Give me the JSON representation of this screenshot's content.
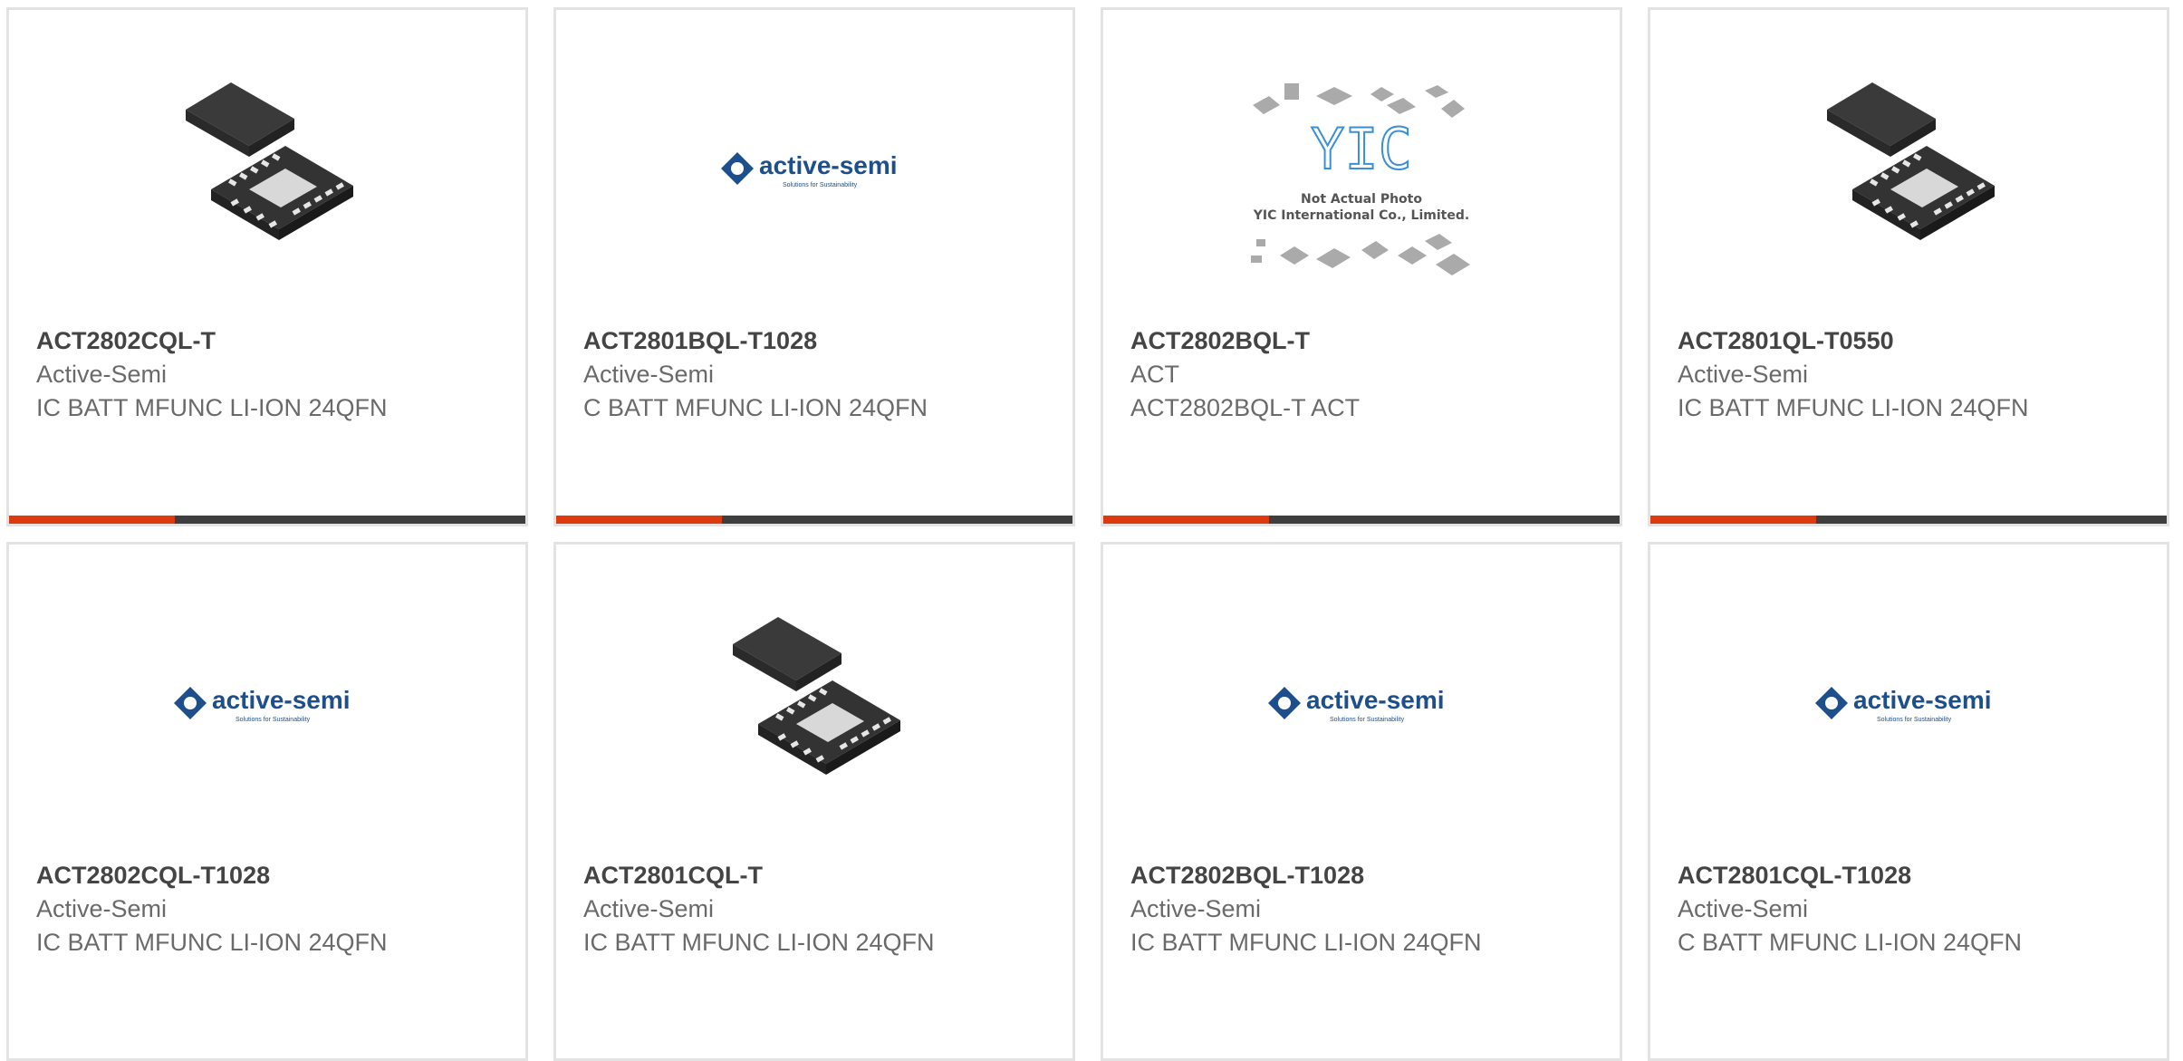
{
  "products": [
    {
      "part": "ACT2802CQL-T",
      "manufacturer": "Active-Semi",
      "description": "IC BATT MFUNC LI-ION 24QFN",
      "image": "qfn-chip-image",
      "logo_text": "",
      "logo_tag": ""
    },
    {
      "part": "ACT2801BQL-T1028",
      "manufacturer": "Active-Semi",
      "description": "C BATT MFUNC LI-ION 24QFN",
      "image": "active-semi-logo",
      "logo_text": "active-semi",
      "logo_tag": "Solutions for Sustainability"
    },
    {
      "part": "ACT2802BQL-T",
      "manufacturer": "ACT",
      "description": "ACT2802BQL-T ACT",
      "image": "not-actual-photo",
      "logo_text": "YIC",
      "note_line1": "Not Actual Photo",
      "note_line2": "YIC International Co., Limited."
    },
    {
      "part": "ACT2801QL-T0550",
      "manufacturer": "Active-Semi",
      "description": "IC BATT MFUNC LI-ION 24QFN",
      "image": "qfn-chip-image",
      "logo_text": "",
      "logo_tag": ""
    },
    {
      "part": "ACT2802CQL-T1028",
      "manufacturer": "Active-Semi",
      "description": "IC BATT MFUNC LI-ION 24QFN",
      "image": "active-semi-logo",
      "logo_text": "active-semi",
      "logo_tag": "Solutions for Sustainability"
    },
    {
      "part": "ACT2801CQL-T",
      "manufacturer": "Active-Semi",
      "description": "IC BATT MFUNC LI-ION 24QFN",
      "image": "qfn-chip-image",
      "logo_text": "",
      "logo_tag": ""
    },
    {
      "part": "ACT2802BQL-T1028",
      "manufacturer": "Active-Semi",
      "description": "IC BATT MFUNC LI-ION 24QFN",
      "image": "active-semi-logo",
      "logo_text": "active-semi",
      "logo_tag": "Solutions for Sustainability"
    },
    {
      "part": "ACT2801CQL-T1028",
      "manufacturer": "Active-Semi",
      "description": "C BATT MFUNC LI-ION 24QFN",
      "image": "active-semi-logo",
      "logo_text": "active-semi",
      "logo_tag": "Solutions for Sustainability"
    }
  ],
  "colors": {
    "accent": "#dd3b0d",
    "bar": "#3e3e3e",
    "border": "#e3e3e3",
    "logo_blue": "#1d4f8c",
    "yic_blue": "#3a8fd6"
  }
}
